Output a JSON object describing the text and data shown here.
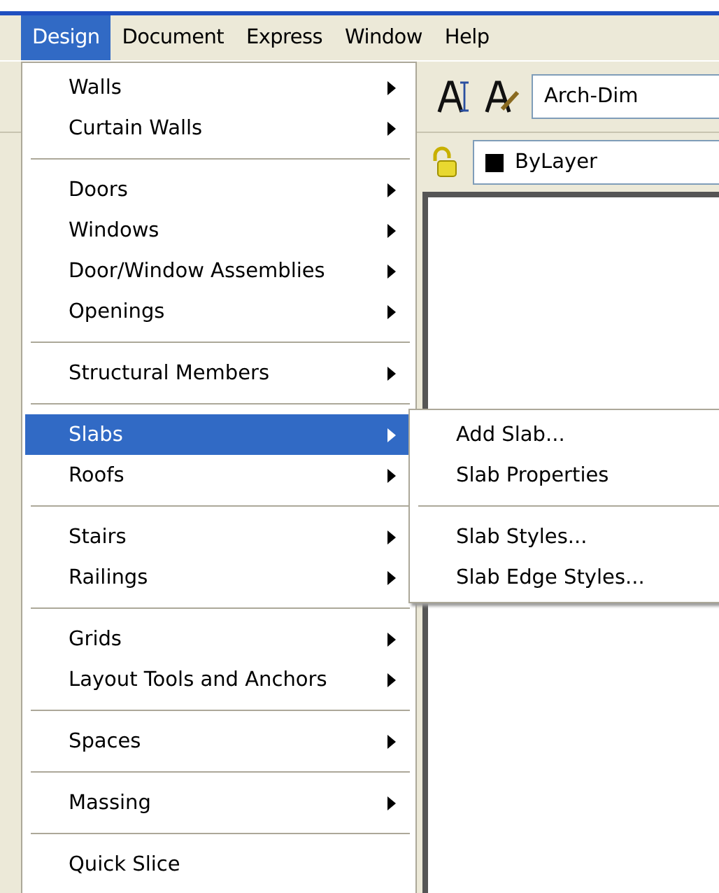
{
  "menubar": [
    {
      "label": "Design",
      "selected": true
    },
    {
      "label": "Document",
      "selected": false
    },
    {
      "label": "Express",
      "selected": false
    },
    {
      "label": "Window",
      "selected": false
    },
    {
      "label": "Help",
      "selected": false
    }
  ],
  "menu": {
    "groups": [
      [
        {
          "label": "Walls",
          "submenu": true,
          "selected": false
        },
        {
          "label": "Curtain Walls",
          "submenu": true,
          "selected": false
        }
      ],
      [
        {
          "label": "Doors",
          "submenu": true,
          "selected": false
        },
        {
          "label": "Windows",
          "submenu": true,
          "selected": false
        },
        {
          "label": "Door/Window Assemblies",
          "submenu": true,
          "selected": false
        },
        {
          "label": "Openings",
          "submenu": true,
          "selected": false
        }
      ],
      [
        {
          "label": "Structural Members",
          "submenu": true,
          "selected": false
        }
      ],
      [
        {
          "label": "Slabs",
          "submenu": true,
          "selected": true
        },
        {
          "label": "Roofs",
          "submenu": true,
          "selected": false
        }
      ],
      [
        {
          "label": "Stairs",
          "submenu": true,
          "selected": false
        },
        {
          "label": "Railings",
          "submenu": true,
          "selected": false
        }
      ],
      [
        {
          "label": "Grids",
          "submenu": true,
          "selected": false
        },
        {
          "label": "Layout Tools and Anchors",
          "submenu": true,
          "selected": false
        }
      ],
      [
        {
          "label": "Spaces",
          "submenu": true,
          "selected": false
        }
      ],
      [
        {
          "label": "Massing",
          "submenu": true,
          "selected": false
        }
      ],
      [
        {
          "label": "Quick Slice",
          "submenu": false,
          "selected": false
        }
      ]
    ]
  },
  "submenu": {
    "groups": [
      [
        {
          "label": "Add Slab..."
        },
        {
          "label": "Slab Properties"
        }
      ],
      [
        {
          "label": "Slab Styles..."
        },
        {
          "label": "Slab Edge Styles..."
        }
      ]
    ]
  },
  "toolbar": {
    "style_field": "Arch-Dim",
    "layer_field": "ByLayer"
  }
}
